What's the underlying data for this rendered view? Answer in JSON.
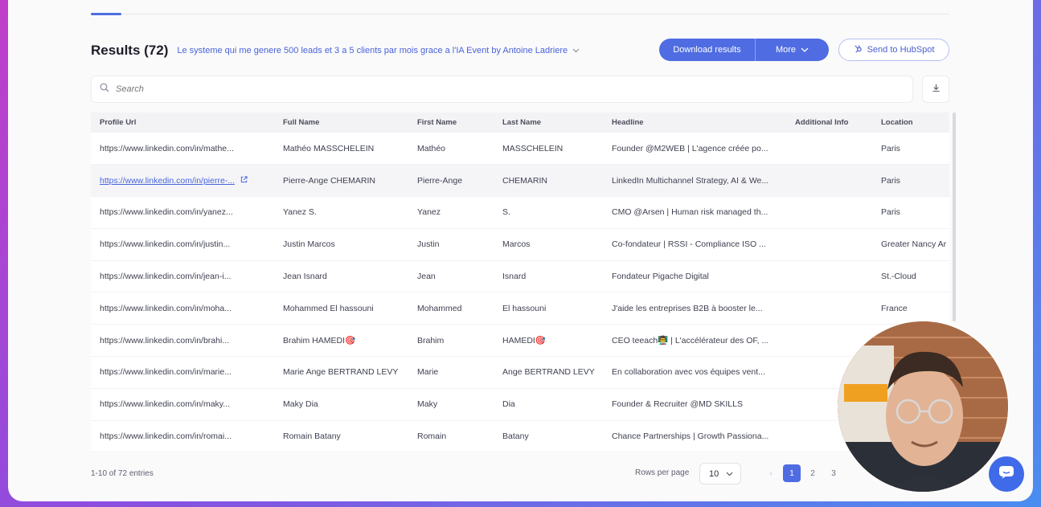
{
  "header": {
    "title": "Results (72)",
    "search_subtitle": "Le systeme qui me genere 500 leads et 3 a 5 clients par mois grace a l'IA Event by Antoine Ladriere"
  },
  "toolbar": {
    "download_label": "Download results",
    "more_label": "More",
    "hubspot_label": "Send to HubSpot"
  },
  "search": {
    "placeholder": "Search"
  },
  "table": {
    "columns": [
      "Profile Url",
      "Full Name",
      "First Name",
      "Last Name",
      "Headline",
      "Additional Info",
      "Location"
    ],
    "rows": [
      [
        "https://www.linkedin.com/in/mathe...",
        "Mathéo MASSCHELEIN",
        "Mathéo",
        "MASSCHELEIN",
        "Founder @M2WEB | L'agence créée po...",
        "",
        "Paris"
      ],
      [
        "https://www.linkedin.com/in/pierre-...",
        "Pierre-Ange CHEMARIN",
        "Pierre-Ange",
        "CHEMARIN",
        "LinkedIn Multichannel Strategy, AI & We...",
        "",
        "Paris"
      ],
      [
        "https://www.linkedin.com/in/yanez...",
        "Yanez S.",
        "Yanez",
        "S.",
        "CMO @Arsen | Human risk managed th...",
        "",
        "Paris"
      ],
      [
        "https://www.linkedin.com/in/justin...",
        "Justin Marcos",
        "Justin",
        "Marcos",
        "Co-fondateur | RSSI - Compliance ISO ...",
        "",
        "Greater Nancy Ar"
      ],
      [
        "https://www.linkedin.com/in/jean-i...",
        "Jean Isnard",
        "Jean",
        "Isnard",
        "Fondateur Pigache Digital",
        "",
        "St.-Cloud"
      ],
      [
        "https://www.linkedin.com/in/moha...",
        "Mohammed El hassouni",
        "Mohammed",
        "El hassouni",
        "J'aide les entreprises B2B à booster le...",
        "",
        "France"
      ],
      [
        "https://www.linkedin.com/in/brahi...",
        "Brahim HAMEDI🎯",
        "Brahim",
        "HAMEDI🎯",
        "CEO teeach👨‍🏫 | L'accélérateur des OF, ...",
        "",
        ""
      ],
      [
        "https://www.linkedin.com/in/marie...",
        "Marie Ange BERTRAND LEVY",
        "Marie",
        "Ange BERTRAND LEVY",
        "En collaboration avec vos équipes vent...",
        "",
        ""
      ],
      [
        "https://www.linkedin.com/in/maky...",
        "Maky Dia",
        "Maky",
        "Dia",
        "Founder & Recruiter @MD SKILLS",
        "",
        ""
      ],
      [
        "https://www.linkedin.com/in/romai...",
        "Romain Batany",
        "Romain",
        "Batany",
        "Chance Partnerships | Growth Passiona...",
        "",
        ""
      ]
    ]
  },
  "footer": {
    "entries_text": "1-10 of 72 entries",
    "rows_per_page_label": "Rows per page",
    "rows_per_page_value": "10",
    "pages": [
      "1",
      "2",
      "3"
    ],
    "prev_glyph": "‹"
  },
  "colors": {
    "accent": "#4f6ce2",
    "link": "#4866d8"
  },
  "icons": {
    "search": "search-icon",
    "download": "download-icon",
    "hubspot": "hubspot-icon",
    "external_link": "external-link-icon",
    "chevron": "chevron-down-icon",
    "chat": "chat-icon"
  }
}
